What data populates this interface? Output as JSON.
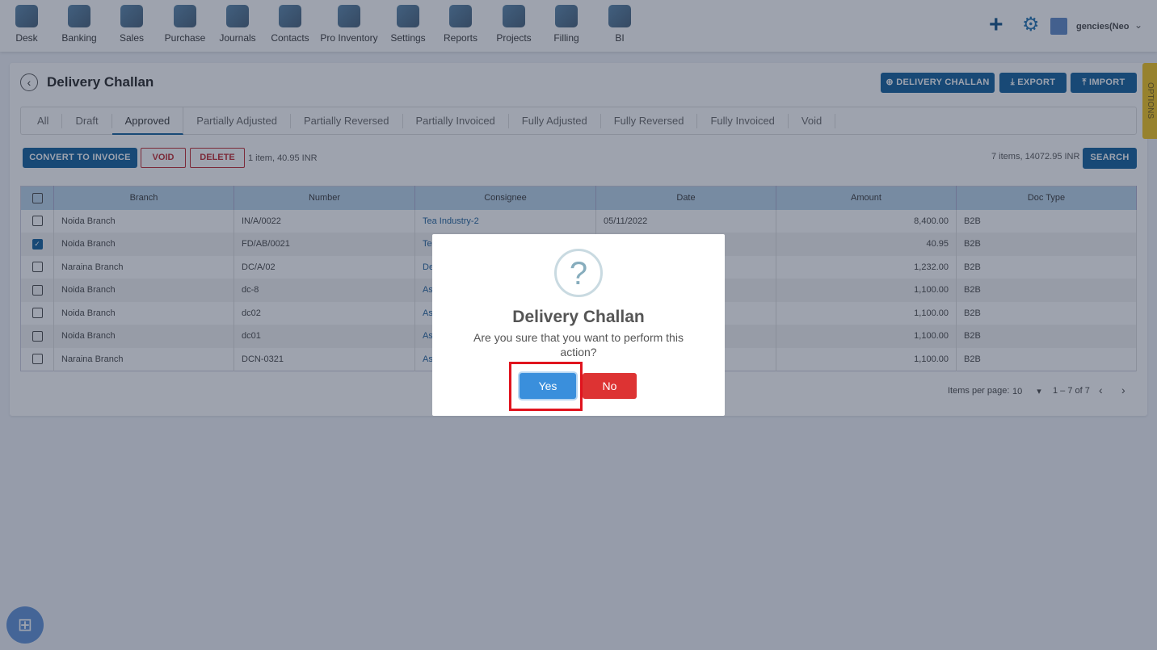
{
  "nav": [
    "Desk",
    "Banking",
    "Sales",
    "Purchase",
    "Journals",
    "Contacts",
    "Pro Inventory",
    "Settings",
    "Reports",
    "Projects",
    "Filling",
    "BI"
  ],
  "header": {
    "user": "gencies(Neo",
    "title": "Delivery Challan",
    "options": "OPTIONS"
  },
  "actions": {
    "add": "DELIVERY CHALLAN",
    "export": "EXPORT",
    "import": "IMPORT",
    "convert": "CONVERT TO INVOICE",
    "void": "VOID",
    "delete": "DELETE",
    "search": "SEARCH"
  },
  "tabs": [
    "All",
    "Draft",
    "Approved",
    "Partially Adjusted",
    "Partially Reversed",
    "Partially Invoiced",
    "Fully Adjusted",
    "Fully Reversed",
    "Fully Invoiced",
    "Void"
  ],
  "active_tab": "Approved",
  "selection_info": "1 item, 40.95 INR",
  "total_info": "7 items, 14072.95 INR",
  "table": {
    "headers": [
      "Branch",
      "Number",
      "Consignee",
      "Date",
      "Amount",
      "Doc Type"
    ],
    "rows": [
      {
        "branch": "Noida Branch",
        "number": "IN/A/0022",
        "consignee": "Tea Industry-2",
        "date": "05/11/2022",
        "amount": "8,400.00",
        "doctype": "B2B",
        "checked": false
      },
      {
        "branch": "Noida Branch",
        "number": "FD/AB/0021",
        "consignee": "Te",
        "date": "",
        "amount": "40.95",
        "doctype": "B2B",
        "checked": true
      },
      {
        "branch": "Naraina Branch",
        "number": "DC/A/02",
        "consignee": "De",
        "date": "",
        "amount": "1,232.00",
        "doctype": "B2B",
        "checked": false
      },
      {
        "branch": "Noida Branch",
        "number": "dc-8",
        "consignee": "Asl",
        "date": "",
        "amount": "1,100.00",
        "doctype": "B2B",
        "checked": false
      },
      {
        "branch": "Noida Branch",
        "number": "dc02",
        "consignee": "Asl",
        "date": "",
        "amount": "1,100.00",
        "doctype": "B2B",
        "checked": false
      },
      {
        "branch": "Noida Branch",
        "number": "dc01",
        "consignee": "Asl",
        "date": "",
        "amount": "1,100.00",
        "doctype": "B2B",
        "checked": false
      },
      {
        "branch": "Naraina Branch",
        "number": "DCN-0321",
        "consignee": "Asl",
        "date": "",
        "amount": "1,100.00",
        "doctype": "B2B",
        "checked": false
      }
    ]
  },
  "pagination": {
    "label": "Items per page:",
    "per_page": "10",
    "range": "1 – 7 of 7"
  },
  "modal": {
    "title": "Delivery Challan",
    "message": "Are you sure that you want to perform this action?",
    "yes": "Yes",
    "no": "No"
  },
  "colors": {
    "primary": "#0b5c9a",
    "danger": "#dd3333",
    "yes": "#3a8fdc",
    "highlight": "#e0141e"
  }
}
